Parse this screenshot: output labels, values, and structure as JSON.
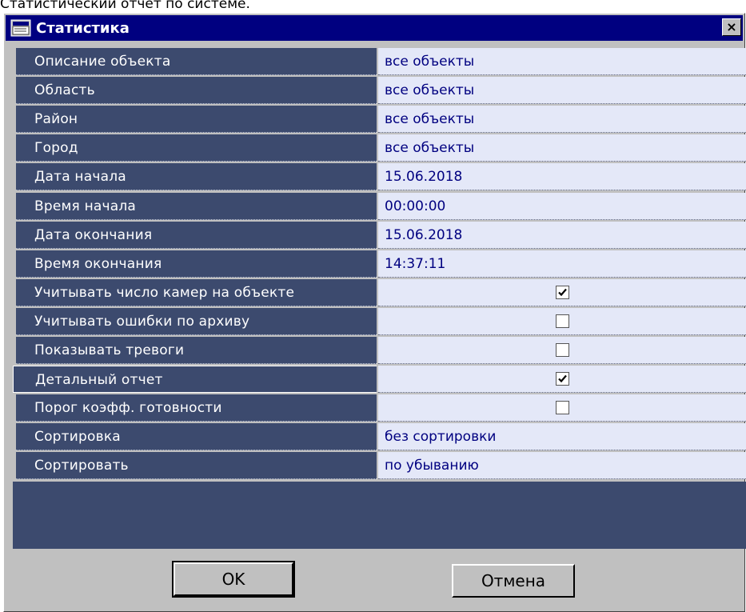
{
  "caption": "Статистический отчет по системе.",
  "window": {
    "title": "Статистика",
    "close_label": "×"
  },
  "rows": [
    {
      "label": "Описание объекта",
      "value": "все объекты"
    },
    {
      "label": "Область",
      "value": "все объекты"
    },
    {
      "label": "Район",
      "value": "все объекты"
    },
    {
      "label": "Город",
      "value": "все объекты"
    },
    {
      "label": "Дата начала",
      "value": "15.06.2018"
    },
    {
      "label": "Время начала",
      "value": "00:00:00"
    },
    {
      "label": "Дата окончания",
      "value": "15.06.2018"
    },
    {
      "label": "Время окончания",
      "value": "14:37:11"
    },
    {
      "label": "Учитывать число камер на объекте",
      "checked": true
    },
    {
      "label": "Учитывать ошибки по архиву",
      "checked": false
    },
    {
      "label": "Показывать тревоги",
      "checked": false
    },
    {
      "label": "Детальный отчет",
      "checked": true,
      "selected": true
    },
    {
      "label": "Порог коэфф. готовности",
      "checked": false
    },
    {
      "label": "Сортировка",
      "value": "без сортировки"
    },
    {
      "label": "Сортировать",
      "value": "по убыванию"
    }
  ],
  "buttons": {
    "ok": "OK",
    "cancel": "Отмена"
  },
  "colors": {
    "titlebar": "#000080",
    "label_bg": "#3c4a6e",
    "value_bg": "#e4e8f8",
    "value_text": "#000080"
  }
}
